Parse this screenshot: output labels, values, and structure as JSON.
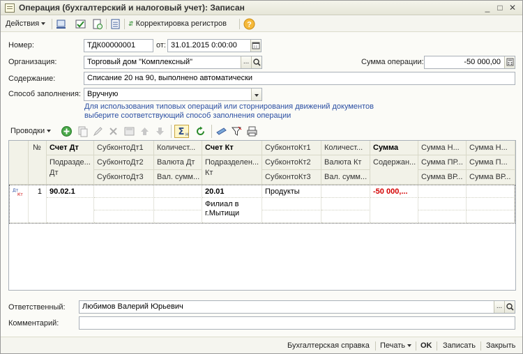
{
  "window": {
    "title": "Операция (бухгалтерский и налоговый учет): Записан"
  },
  "toolbar": {
    "actions_label": "Действия",
    "correction_label": "Корректировка регистров",
    "help_icon": "?"
  },
  "form": {
    "number_label": "Номер:",
    "number_value": "ТДК00000001",
    "date_label": "от:",
    "date_value": "31.01.2015  0:00:00",
    "org_label": "Организация:",
    "org_value": "Торговый дом \"Комплексный\"",
    "sum_label": "Сумма операции:",
    "sum_value": "-50 000,00",
    "content_label": "Содержание:",
    "content_value": "Списание 20 на 90, выполнено автоматически",
    "fill_label": "Способ заполнения:",
    "fill_value": "Вручную",
    "hint_line1": "Для использования типовых операций или сторнирования движений документов",
    "hint_line2": "выберите соответствующий способ заполнения операции"
  },
  "grid_toolbar": {
    "postings_label": "Проводки"
  },
  "grid": {
    "headers": {
      "num": "№",
      "dt_account": "Счет Дт",
      "dt_div": "Подразде... Дт",
      "subdt1": "СубконтоДт1",
      "subdt2": "СубконтоДт2",
      "subdt3": "СубконтоДт3",
      "qty_dt": "Количест...",
      "cur_dt": "Валюта Дт",
      "valsum_dt": "Вал. сумм...",
      "kt_account": "Счет Кт",
      "kt_div": "Подразделен... Кт",
      "subkt1": "СубконтоКт1",
      "subkt2": "СубконтоКт2",
      "subkt3": "СубконтоКт3",
      "qty_kt": "Количест...",
      "cur_kt": "Валюта Кт",
      "valsum_kt": "Вал. сумм...",
      "sum": "Сумма",
      "content": "Содержан...",
      "sum_n1": "Сумма Н...",
      "sum_pr1": "Сумма ПР...",
      "sum_vr1": "Сумма ВР...",
      "sum_n2": "Сумма Н...",
      "sum_pr2": "Сумма П...",
      "sum_vr2": "Сумма ВР..."
    },
    "rows": [
      {
        "num": "1",
        "dt_account": "90.02.1",
        "kt_account": "20.01",
        "kt_div": "Филиал в г.Мытищи",
        "subkt1": "Продукты",
        "sum": "-50 000,..."
      }
    ]
  },
  "footer": {
    "responsible_label": "Ответственный:",
    "responsible_value": "Любимов Валерий Юрьевич",
    "comment_label": "Комментарий:",
    "comment_value": ""
  },
  "bottom_bar": {
    "report_label": "Бухгалтерская справка",
    "print_label": "Печать",
    "ok_label": "OK",
    "save_label": "Записать",
    "close_label": "Закрыть"
  },
  "colors": {
    "accent_blue": "#2b4fa3",
    "negative_red": "#d40000",
    "selected_green": "#3a9a3a"
  }
}
